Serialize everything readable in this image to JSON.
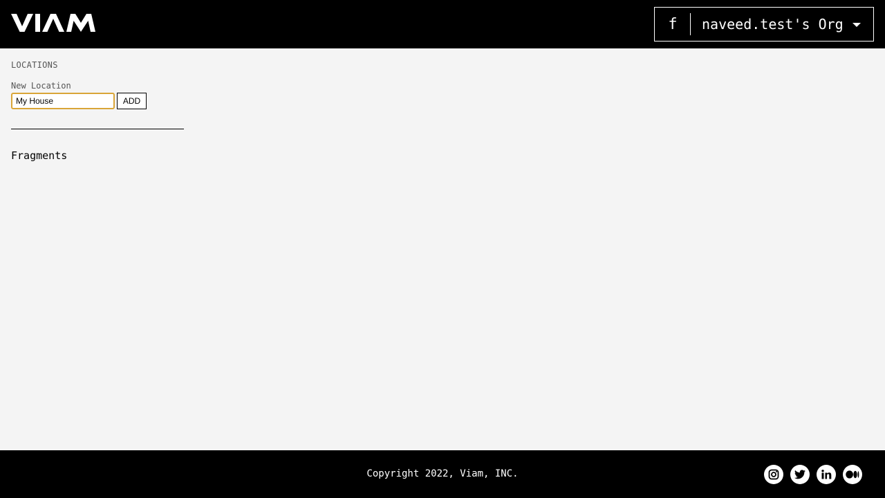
{
  "header": {
    "logo_text": "VIAM",
    "org_switcher": {
      "initial": "f",
      "name": "naveed.test's Org"
    }
  },
  "sidebar": {
    "heading": "LOCATIONS",
    "new_location": {
      "label": "New Location",
      "value": "My House",
      "button_label": "ADD"
    },
    "fragments_label": "Fragments"
  },
  "footer": {
    "copyright": "Copyright 2022, Viam, INC.",
    "social_icons": [
      "instagram-icon",
      "twitter-icon",
      "linkedin-icon",
      "medium-icon"
    ]
  }
}
